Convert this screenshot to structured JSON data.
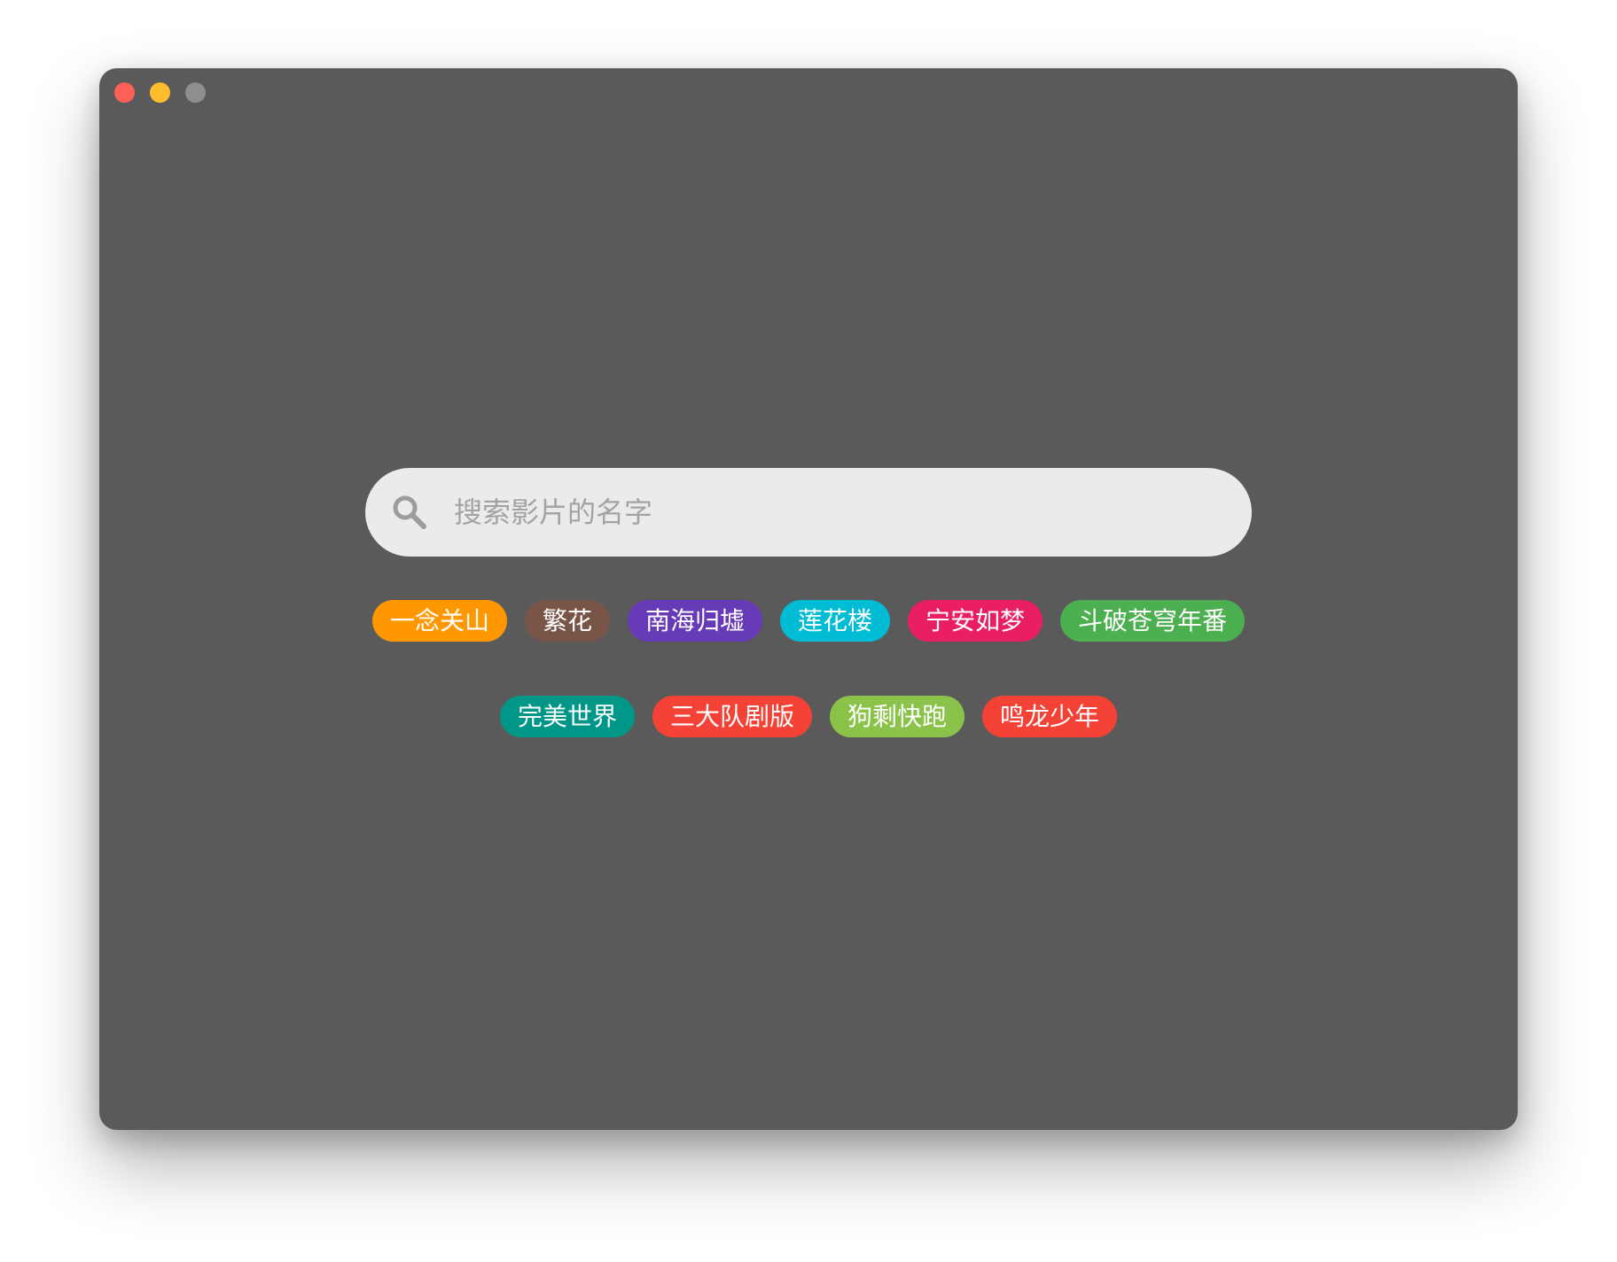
{
  "window": {
    "buttons": [
      {
        "name": "close",
        "color": "#fe5f57"
      },
      {
        "name": "minimize",
        "color": "#febc2e"
      },
      {
        "name": "zoom",
        "color": "#8e8e8e"
      }
    ],
    "background": "#5a5a5a"
  },
  "search": {
    "placeholder": "搜索影片的名字",
    "value": "",
    "icon": "search-icon",
    "icon_color": "#9c9c9e"
  },
  "tags": [
    {
      "label": "一念关山",
      "color": "#ff9800"
    },
    {
      "label": "繁花",
      "color": "#795548"
    },
    {
      "label": "南海归墟",
      "color": "#673ab7"
    },
    {
      "label": "莲花楼",
      "color": "#00bcd4"
    },
    {
      "label": "宁安如梦",
      "color": "#e91e63"
    },
    {
      "label": "斗破苍穹年番",
      "color": "#4caf50"
    },
    {
      "label": "完美世界",
      "color": "#009688"
    },
    {
      "label": "三大队剧版",
      "color": "#f44336"
    },
    {
      "label": "狗剩快跑",
      "color": "#8bc34a"
    },
    {
      "label": "鸣龙少年",
      "color": "#f44336"
    }
  ]
}
